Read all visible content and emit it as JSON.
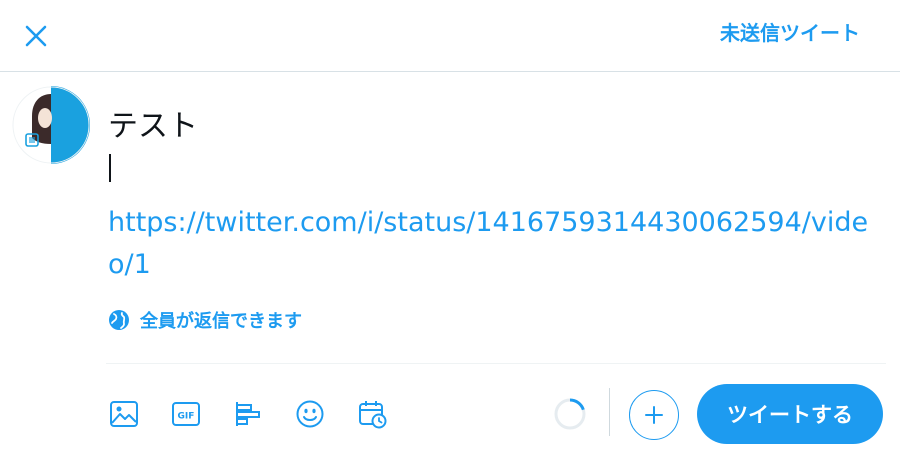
{
  "header": {
    "close_icon": "close-icon",
    "drafts_label": "未送信ツイート"
  },
  "colors": {
    "accent": "#1d9bf0",
    "text": "#0f1419",
    "divider": "#d8e1e6"
  },
  "compose": {
    "line1": "テスト",
    "url": "https://twitter.com/i/status/1416759314430062594/video/1"
  },
  "reply_setting": {
    "icon": "globe-icon",
    "label": "全員が返信できます"
  },
  "toolbar": {
    "icons": [
      "image-icon",
      "gif-icon",
      "poll-icon",
      "emoji-icon",
      "schedule-icon"
    ],
    "gif_text": "GIF",
    "add_icon": "plus-icon",
    "tweet_label": "ツイートする"
  }
}
